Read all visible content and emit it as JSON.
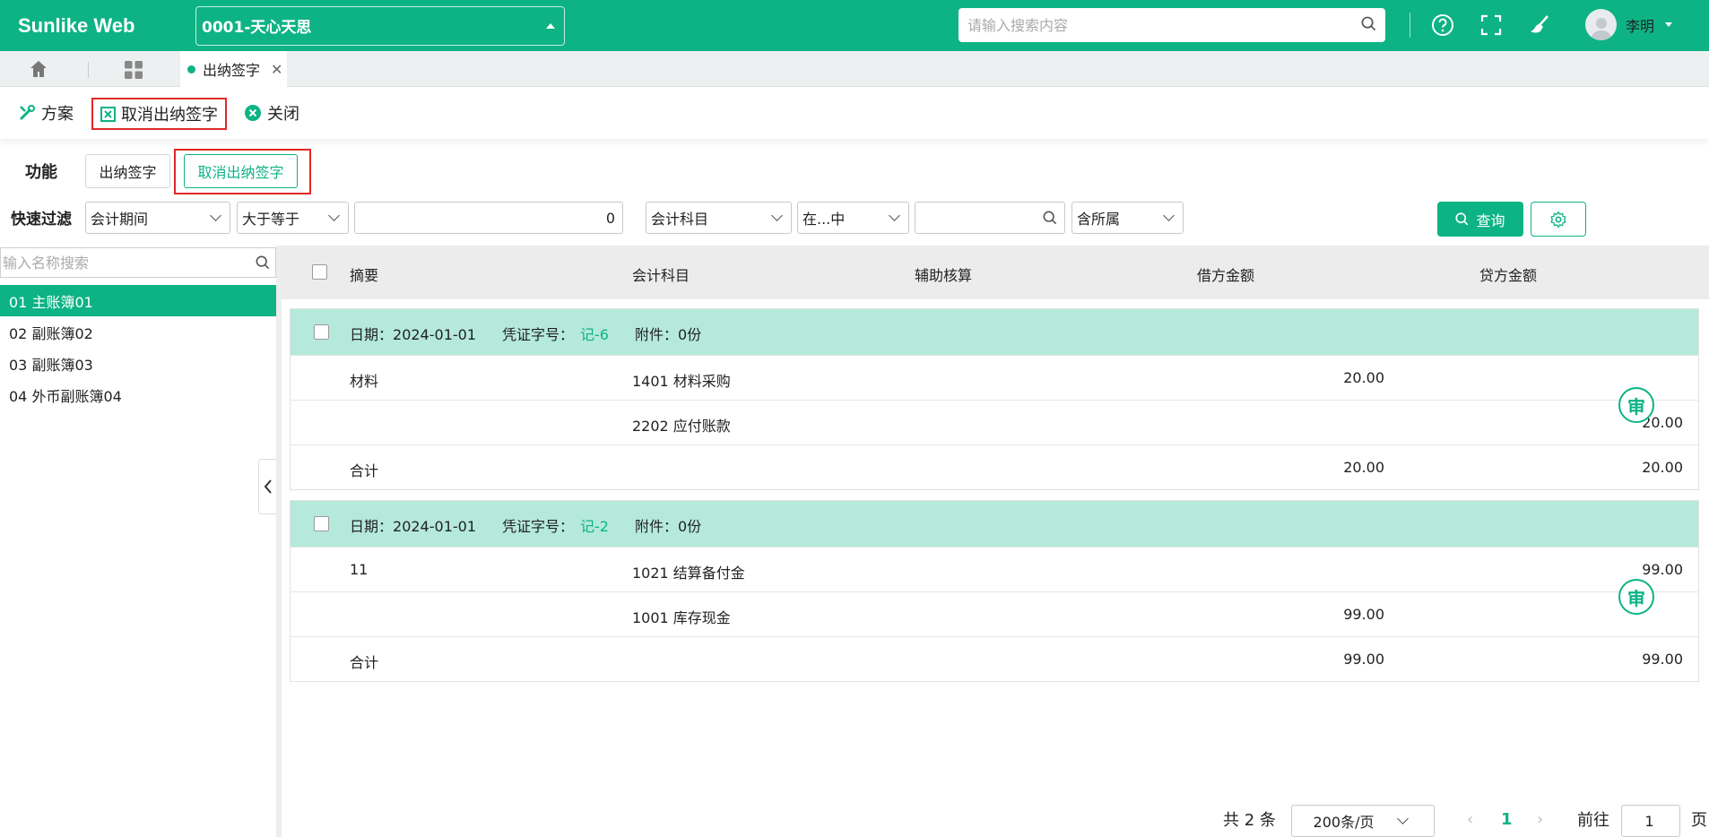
{
  "app": {
    "brand": "Sunlike Web"
  },
  "header": {
    "org_selected": "0001-天心天思",
    "search_placeholder": "请输入搜索内容",
    "user_name": "李明"
  },
  "tabs": {
    "active_label": "出纳签字"
  },
  "toolbar": {
    "scheme": "方案",
    "cancel_sign": "取消出纳签字",
    "close": "关闭"
  },
  "function": {
    "label": "功能",
    "sign": "出纳签字",
    "cancel_sign": "取消出纳签字"
  },
  "quick_filter": {
    "label": "快速过滤",
    "field1": "会计期间",
    "op1": "大于等于",
    "value1": "0",
    "field2": "会计科目",
    "op2": "在...中",
    "value2": "",
    "scope": "含所属",
    "query": "查询"
  },
  "left": {
    "search_placeholder": "输入名称搜索",
    "books": [
      "01 主账簿01",
      "02 副账簿02",
      "03 副账簿03",
      "04 外币副账簿04"
    ],
    "active_index": 0
  },
  "grid": {
    "columns": [
      "摘要",
      "会计科目",
      "辅助核算",
      "借方金额",
      "贷方金额"
    ],
    "date_label": "日期：",
    "voucher_label": "凭证字号：",
    "attach_label": "附件：",
    "stamp_text": "审",
    "vouchers": [
      {
        "date": "2024-01-01",
        "voucher_no": "记-6",
        "attachments": "0份",
        "rows": [
          {
            "summary": "材料",
            "account": "1401 材料采购",
            "aux": "",
            "debit": "20.00",
            "credit": ""
          },
          {
            "summary": "",
            "account": "2202 应付账款",
            "aux": "",
            "debit": "",
            "credit": "20.00"
          },
          {
            "summary": "合计",
            "account": "",
            "aux": "",
            "debit": "20.00",
            "credit": "20.00"
          }
        ]
      },
      {
        "date": "2024-01-01",
        "voucher_no": "记-2",
        "attachments": "0份",
        "rows": [
          {
            "summary": "11",
            "account": "1021 结算备付金",
            "aux": "",
            "debit": "",
            "credit": "99.00"
          },
          {
            "summary": "",
            "account": "1001 库存现金",
            "aux": "",
            "debit": "99.00",
            "credit": ""
          },
          {
            "summary": "合计",
            "account": "",
            "aux": "",
            "debit": "99.00",
            "credit": "99.00"
          }
        ]
      }
    ]
  },
  "pager": {
    "total": "共 2 条",
    "page_size": "200条/页",
    "current": "1",
    "goto_label": "前往",
    "goto_value": "1",
    "page_suffix": "页"
  },
  "colors": {
    "accent": "#0db385",
    "group_bg": "#b4e9db",
    "highlight": "#e02828"
  }
}
